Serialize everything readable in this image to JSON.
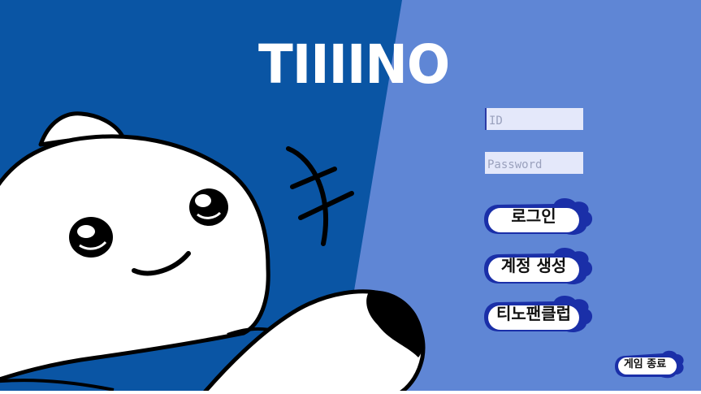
{
  "theme": {
    "left_bg": "#0a55a4",
    "right_bg": "#5f86d5",
    "button_fill": "#ffffff",
    "button_border": "#1a2fa8",
    "field_bg": "#e4e8fa"
  },
  "logo": {
    "text": "TIIIINO"
  },
  "login_form": {
    "id_placeholder": "ID",
    "password_placeholder": "Password"
  },
  "buttons": {
    "login": "로그인",
    "create_account": "계정 생성",
    "fan_club": "티노팬클럽",
    "exit": "게임 종료"
  },
  "mascot": {
    "icon": "white-blob-mascot"
  }
}
